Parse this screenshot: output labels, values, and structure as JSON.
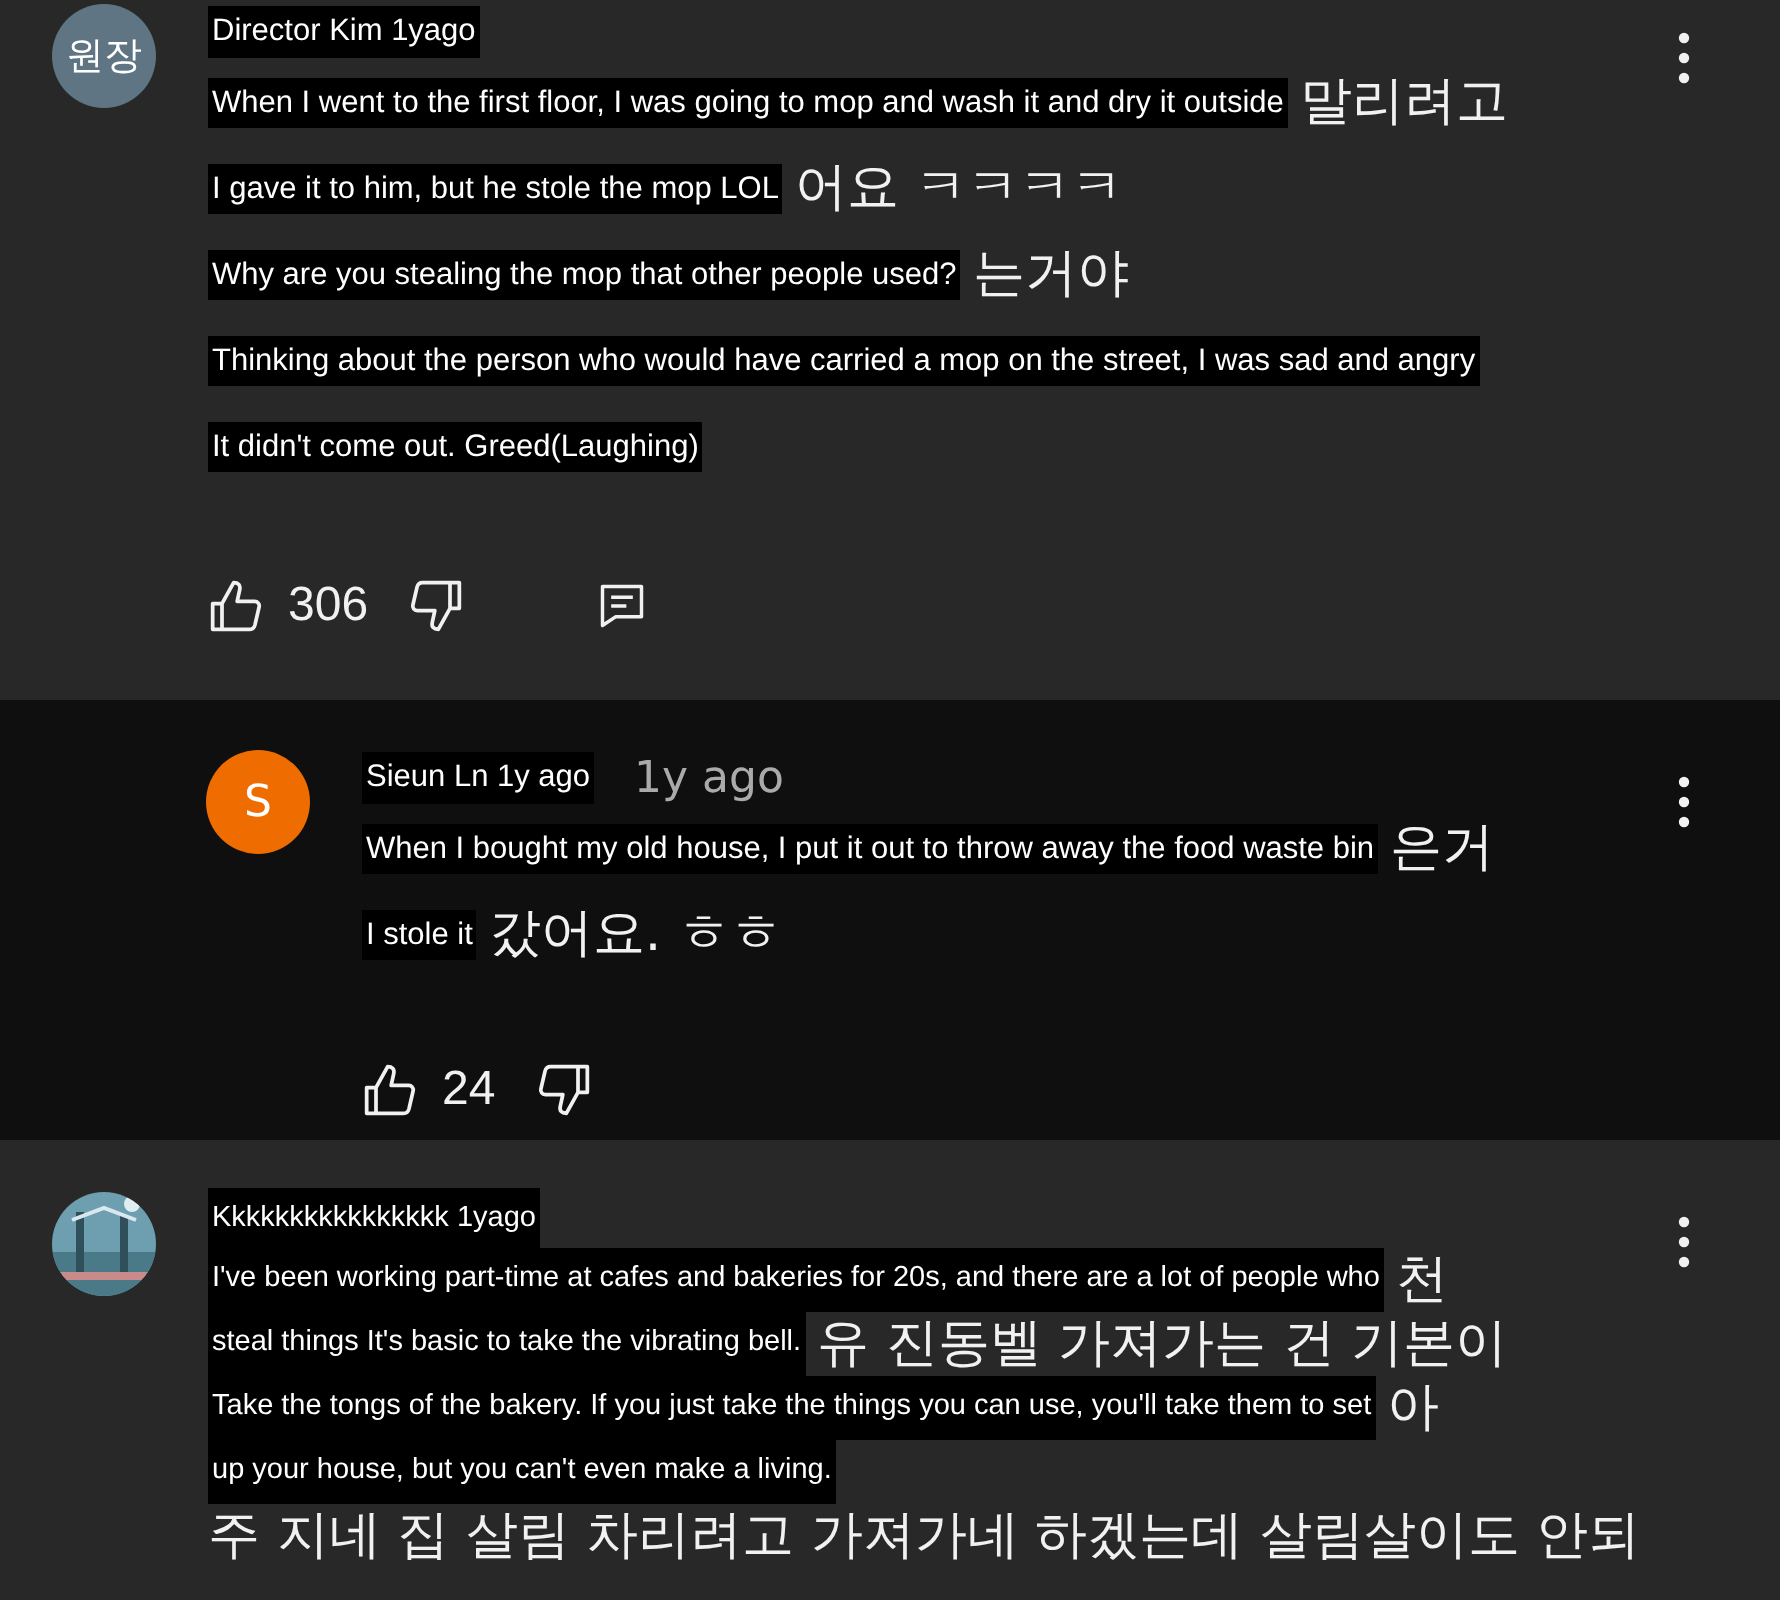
{
  "comments": [
    {
      "reply": false,
      "avatar": {
        "kind": "text",
        "text": "원장",
        "color": "#5f7584"
      },
      "header": {
        "overlay": "Director Kim 1yago"
      },
      "lines": [
        {
          "overlay": "When I went to the first floor, I was going to mop and wash it and dry it outside",
          "tail": "말리려고"
        },
        {
          "overlay": "I gave it to him, but he stole the mop LOL",
          "tail": "어요 ㅋㅋㅋㅋ"
        },
        {
          "overlay": "Why are you stealing the mop that other people used?",
          "tail": "는거야"
        },
        {
          "overlay": "Thinking about the person who would have carried a mop on the street, I was sad and angry"
        },
        {
          "overlay": "It didn't come out. Greed(Laughing)"
        }
      ],
      "likes": "306",
      "reply_button": true
    },
    {
      "reply": true,
      "avatar": {
        "kind": "text",
        "text": "S",
        "color": "#ef6c00"
      },
      "header": {
        "overlay": "Sieun Ln 1y ago",
        "tail": "1y ago"
      },
      "lines": [
        {
          "overlay": "When I bought my old house, I put it out to throw away the food waste bin",
          "tail": "은거"
        },
        {
          "overlay": "I stole it",
          "tail": "갔어요. ㅎㅎ"
        }
      ],
      "likes": "24",
      "reply_button": false
    },
    {
      "reply": false,
      "header": {
        "overlay": "Kkkkkkkkkkkkkkkk 1yago"
      },
      "lines": [
        {
          "overlay": "I've been working part-time at cafes and bakeries for 20s, and there are a lot of people who",
          "tail": "천"
        },
        {
          "overlay": "steal things It's basic to take the vibrating bell.",
          "tail": "유     진동벨 가져가는 건 기본이"
        },
        {
          "overlay": "Take the tongs of the bakery. If you just take the things you can use, you'll take them to set",
          "tail": "아"
        },
        {
          "overlay": "up your house, but you can't even make a living."
        },
        {
          "tail": "주 지네 집 살림 차리려고 가져가네 하겠는데  살림살이도 안되"
        }
      ]
    }
  ]
}
